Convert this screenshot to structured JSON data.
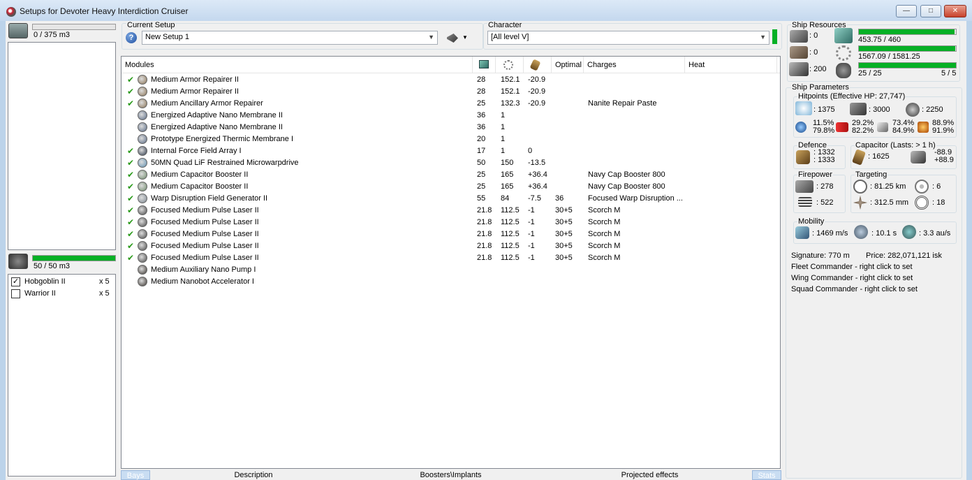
{
  "window": {
    "title": "Setups for Devoter Heavy Interdiction Cruiser"
  },
  "cargo": {
    "value": "0 / 375 m3"
  },
  "drone_bay": {
    "value": "50 / 50 m3",
    "bar_fill_pct": 100,
    "drones": [
      {
        "name": "Hobgoblin II",
        "qty": "x 5",
        "checked": true
      },
      {
        "name": "Warrior II",
        "qty": "x 5",
        "checked": false
      }
    ]
  },
  "current_setup": {
    "label": "Current Setup",
    "value": "New Setup 1",
    "help_icon": "question-icon"
  },
  "character": {
    "label": "Character",
    "value": "[All level V]"
  },
  "grid": {
    "headers": {
      "modules": "Modules",
      "optimal": "Optimal",
      "charges": "Charges",
      "heat": "Heat"
    },
    "rows": [
      {
        "active": true,
        "name": "Medium Armor Repairer II",
        "pg": "28",
        "cpu": "152.1",
        "cap": "-20.9",
        "optimal": "",
        "charges": "",
        "icon_color": "#8a7355"
      },
      {
        "active": true,
        "name": "Medium Armor Repairer II",
        "pg": "28",
        "cpu": "152.1",
        "cap": "-20.9",
        "optimal": "",
        "charges": "",
        "icon_color": "#8a7355"
      },
      {
        "active": true,
        "name": "Medium Ancillary Armor Repairer",
        "pg": "25",
        "cpu": "132.3",
        "cap": "-20.9",
        "optimal": "",
        "charges": "Nanite Repair Paste",
        "icon_color": "#8a7355"
      },
      {
        "active": false,
        "name": "Energized Adaptive Nano Membrane II",
        "pg": "36",
        "cpu": "1",
        "cap": "",
        "optimal": "",
        "charges": "",
        "icon_color": "#5a6b85"
      },
      {
        "active": false,
        "name": "Energized Adaptive Nano Membrane II",
        "pg": "36",
        "cpu": "1",
        "cap": "",
        "optimal": "",
        "charges": "",
        "icon_color": "#5a6b85"
      },
      {
        "active": false,
        "name": "Prototype Energized Thermic Membrane I",
        "pg": "20",
        "cpu": "1",
        "cap": "",
        "optimal": "",
        "charges": "",
        "icon_color": "#5a6b85"
      },
      {
        "active": true,
        "name": "Internal Force Field Array I",
        "pg": "17",
        "cpu": "1",
        "cap": "0",
        "optimal": "",
        "charges": "",
        "icon_color": "#2f3a4c"
      },
      {
        "active": true,
        "name": "50MN Quad LiF Restrained Microwarpdrive",
        "pg": "50",
        "cpu": "150",
        "cap": "-13.5",
        "optimal": "",
        "charges": "",
        "icon_color": "#5f8fb0"
      },
      {
        "active": true,
        "name": "Medium Capacitor Booster II",
        "pg": "25",
        "cpu": "165",
        "cap": "+36.4",
        "optimal": "",
        "charges": "Navy Cap Booster 800",
        "icon_color": "#6e8a6a"
      },
      {
        "active": true,
        "name": "Medium Capacitor Booster II",
        "pg": "25",
        "cpu": "165",
        "cap": "+36.4",
        "optimal": "",
        "charges": "Navy Cap Booster 800",
        "icon_color": "#6e8a6a"
      },
      {
        "active": true,
        "name": "Warp Disruption Field Generator II",
        "pg": "55",
        "cpu": "84",
        "cap": "-7.5",
        "optimal": "36",
        "charges": "Focused Warp Disruption ...",
        "icon_color": "#7d8791"
      },
      {
        "active": true,
        "name": "Focused Medium Pulse Laser II",
        "pg": "21.8",
        "cpu": "112.5",
        "cap": "-1",
        "optimal": "30+5",
        "charges": "Scorch M",
        "icon_color": "#4a4a4a"
      },
      {
        "active": true,
        "name": "Focused Medium Pulse Laser II",
        "pg": "21.8",
        "cpu": "112.5",
        "cap": "-1",
        "optimal": "30+5",
        "charges": "Scorch M",
        "icon_color": "#4a4a4a"
      },
      {
        "active": true,
        "name": "Focused Medium Pulse Laser II",
        "pg": "21.8",
        "cpu": "112.5",
        "cap": "-1",
        "optimal": "30+5",
        "charges": "Scorch M",
        "icon_color": "#4a4a4a"
      },
      {
        "active": true,
        "name": "Focused Medium Pulse Laser II",
        "pg": "21.8",
        "cpu": "112.5",
        "cap": "-1",
        "optimal": "30+5",
        "charges": "Scorch M",
        "icon_color": "#4a4a4a"
      },
      {
        "active": true,
        "name": "Focused Medium Pulse Laser II",
        "pg": "21.8",
        "cpu": "112.5",
        "cap": "-1",
        "optimal": "30+5",
        "charges": "Scorch M",
        "icon_color": "#4a4a4a"
      },
      {
        "active": false,
        "name": "Medium Auxiliary Nano Pump I",
        "pg": "",
        "cpu": "",
        "cap": "",
        "optimal": "",
        "charges": "",
        "icon_color": "#3a3530"
      },
      {
        "active": false,
        "name": "Medium Nanobot Accelerator I",
        "pg": "",
        "cpu": "",
        "cap": "",
        "optimal": "",
        "charges": "",
        "icon_color": "#3a3530"
      }
    ]
  },
  "tabs": {
    "bays": "Bays",
    "description": "Description",
    "boosters": "Boosters\\Implants",
    "projected": "Projected effects",
    "stats": "Stats"
  },
  "resources": {
    "title": "Ship Resources",
    "turret_hardpoints": "0",
    "launcher_hardpoints": "0",
    "drone_bandwidth": "200",
    "powergrid": "453.75 / 460",
    "powergrid_pct": 98.6,
    "cpu": "1567.09 / 1581.25",
    "cpu_pct": 99.1,
    "calibration": "25 / 25",
    "calibration_pct": 100,
    "rig_slots": "5 / 5"
  },
  "parameters": {
    "title": "Ship Parameters",
    "hitpoints_title": "Hitpoints (Effective HP: 27,747)",
    "shield_hp": ": 1375",
    "armor_hp": ": 3000",
    "structure_hp": ": 2250",
    "resists": {
      "em_top": "11.5%",
      "em_bottom": "79.8%",
      "therm_top": "29.2%",
      "therm_bottom": "82.2%",
      "kin_top": "73.4%",
      "kin_bottom": "84.9%",
      "exp_top": "88.9%",
      "exp_bottom": "91.9%"
    },
    "defence_title": "Defence",
    "defence_top": ": 1332",
    "defence_bottom": ": 1333",
    "capacitor_title": "Capacitor (Lasts: > 1 h)",
    "capacitor_amount": ": 1625",
    "capacitor_top": "-88.9",
    "capacitor_bottom": "+88.9",
    "firepower_title": "Firepower",
    "firepower_turret": ": 278",
    "firepower_drone": ": 522",
    "targeting_title": "Targeting",
    "targeting_range": ": 81.25 km",
    "targeting_max": ": 6",
    "scan_res": ": 312.5 mm",
    "sensor_strength": ": 18",
    "mobility_title": "Mobility",
    "velocity": ": 1469 m/s",
    "align": ": 10.1 s",
    "warp": ": 3.3 au/s",
    "signature": "Signature: 770 m",
    "price": "Price: 282,071,121 isk",
    "fleet_commander": "Fleet Commander - right click to set",
    "wing_commander": "Wing Commander - right click to set",
    "squad_commander": "Squad Commander - right click to set"
  },
  "colors": {
    "accent": "#06b025",
    "title_bg": "#c4d8ee"
  }
}
